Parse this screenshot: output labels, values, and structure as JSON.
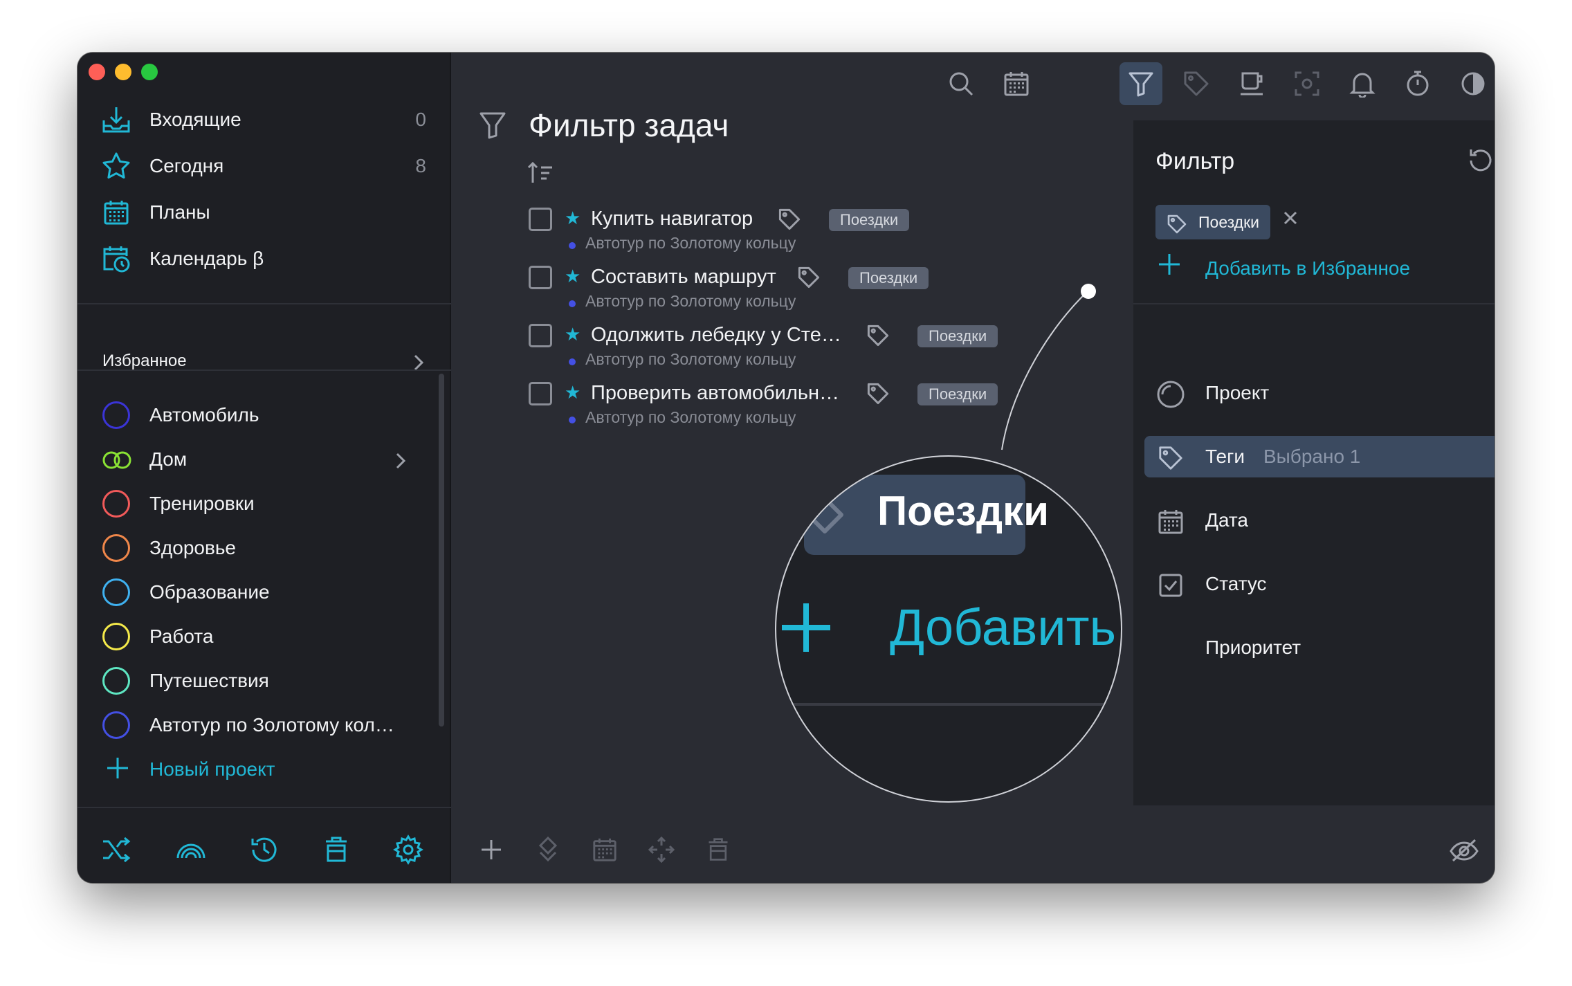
{
  "sidebar": {
    "nav": [
      {
        "label": "Входящие",
        "count": "0",
        "icon": "inbox-icon"
      },
      {
        "label": "Сегодня",
        "count": "8",
        "icon": "star-icon"
      },
      {
        "label": "Планы",
        "count": "",
        "icon": "calendar-grid-icon"
      },
      {
        "label": "Календарь β",
        "count": "",
        "icon": "calendar-clock-icon"
      }
    ],
    "favorites_label": "Избранное",
    "projects": [
      {
        "label": "Автомобиль",
        "color": "#3b34d6"
      },
      {
        "label": "Дом",
        "color": "#8ae234"
      },
      {
        "label": "Тренировки",
        "color": "#f25a5a"
      },
      {
        "label": "Здоровье",
        "color": "#f0874a"
      },
      {
        "label": "Образование",
        "color": "#3fb1f0"
      },
      {
        "label": "Работа",
        "color": "#f4e94a"
      },
      {
        "label": "Путешествия",
        "color": "#5ee6c2"
      },
      {
        "label": "Автотур по Золотому кол…",
        "color": "#4450e4"
      }
    ],
    "new_project_label": "Новый проект"
  },
  "main": {
    "title": "Фильтр задач",
    "tasks": [
      {
        "title": "Купить навигатор",
        "tag": "Поездки",
        "project": "Автотур по Золотому кольцу"
      },
      {
        "title": "Составить маршрут",
        "tag": "Поездки",
        "project": "Автотур по Золотому кольцу"
      },
      {
        "title": "Одолжить лебедку у Сте…",
        "tag": "Поездки",
        "project": "Автотур по Золотому кольцу"
      },
      {
        "title": "Проверить автомобильн…",
        "tag": "Поездки",
        "project": "Автотур по Золотому кольцу"
      }
    ]
  },
  "filter_panel": {
    "title": "Фильтр",
    "active_chip": "Поездки",
    "add_favorite_label": "Добавить в Избранное",
    "rows": [
      {
        "label": "Проект",
        "value": ""
      },
      {
        "label": "Теги",
        "value": "Выбрано 1"
      },
      {
        "label": "Дата",
        "value": ""
      },
      {
        "label": "Статус",
        "value": ""
      },
      {
        "label": "Приоритет",
        "value": ""
      }
    ]
  },
  "magnifier": {
    "chip_text": "Поездки",
    "add_text": "Добавить"
  },
  "colors": {
    "accent": "#21b8d6",
    "selected_bg": "#3b4a60"
  }
}
